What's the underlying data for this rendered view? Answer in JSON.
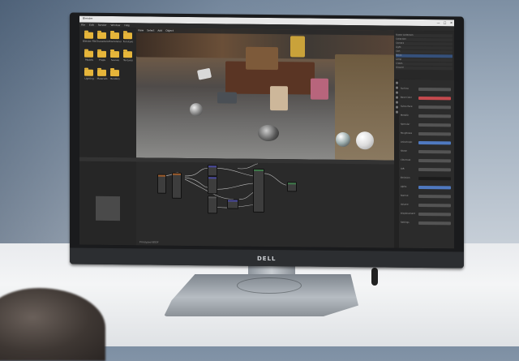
{
  "window": {
    "title": "Blender",
    "minimize": "—",
    "maximize": "□",
    "close": "✕"
  },
  "menus": [
    "File",
    "Edit",
    "Render",
    "Window",
    "Help"
  ],
  "viewport_toolbar": [
    "View",
    "Select",
    "Add",
    "Object"
  ],
  "file_browser": {
    "folders": [
      {
        "label": "Blender Files"
      },
      {
        "label": "Characters"
      },
      {
        "label": "Environment"
      },
      {
        "label": "Furniture"
      },
      {
        "label": "Models"
      },
      {
        "label": "Props"
      },
      {
        "label": "Scenes"
      },
      {
        "label": "Textures"
      },
      {
        "label": "Lighting"
      },
      {
        "label": "Materials"
      },
      {
        "label": "Renders"
      }
    ]
  },
  "node_editor": {
    "status": "Principled BSDF"
  },
  "outliner": {
    "rows": [
      {
        "label": "Scene Collection",
        "selected": false
      },
      {
        "label": "Collection",
        "selected": false
      },
      {
        "label": "Camera",
        "selected": false
      },
      {
        "label": "Light",
        "selected": false
      },
      {
        "label": "Cart",
        "selected": false
      },
      {
        "label": "Robot",
        "selected": true
      },
      {
        "label": "Lamp",
        "selected": false
      },
      {
        "label": "Crates",
        "selected": false
      },
      {
        "label": "Ground",
        "selected": false
      }
    ]
  },
  "properties": {
    "rows": [
      {
        "label": "Surface",
        "style": "normal"
      },
      {
        "label": "Base Color",
        "style": "red"
      },
      {
        "label": "Subsurface",
        "style": "normal"
      },
      {
        "label": "Metallic",
        "style": "normal"
      },
      {
        "label": "Specular",
        "style": "normal"
      },
      {
        "label": "Roughness",
        "style": "normal"
      },
      {
        "label": "Anisotropic",
        "style": "blue"
      },
      {
        "label": "Sheen",
        "style": "normal"
      },
      {
        "label": "Clearcoat",
        "style": "normal"
      },
      {
        "label": "IOR",
        "style": "normal"
      },
      {
        "label": "Emission",
        "style": "dark"
      },
      {
        "label": "Alpha",
        "style": "blue"
      },
      {
        "label": "Normal",
        "style": "normal"
      },
      {
        "label": "Volume",
        "style": "normal"
      },
      {
        "label": "Displacement",
        "style": "normal"
      },
      {
        "label": "Settings",
        "style": "normal"
      }
    ]
  },
  "brand": {
    "monitor_logo": "DELL"
  },
  "colors": {
    "folder": "#e6b53a",
    "selection": "#35507a",
    "base_color": "#c54a4e",
    "accent_blue": "#4f79c0"
  }
}
